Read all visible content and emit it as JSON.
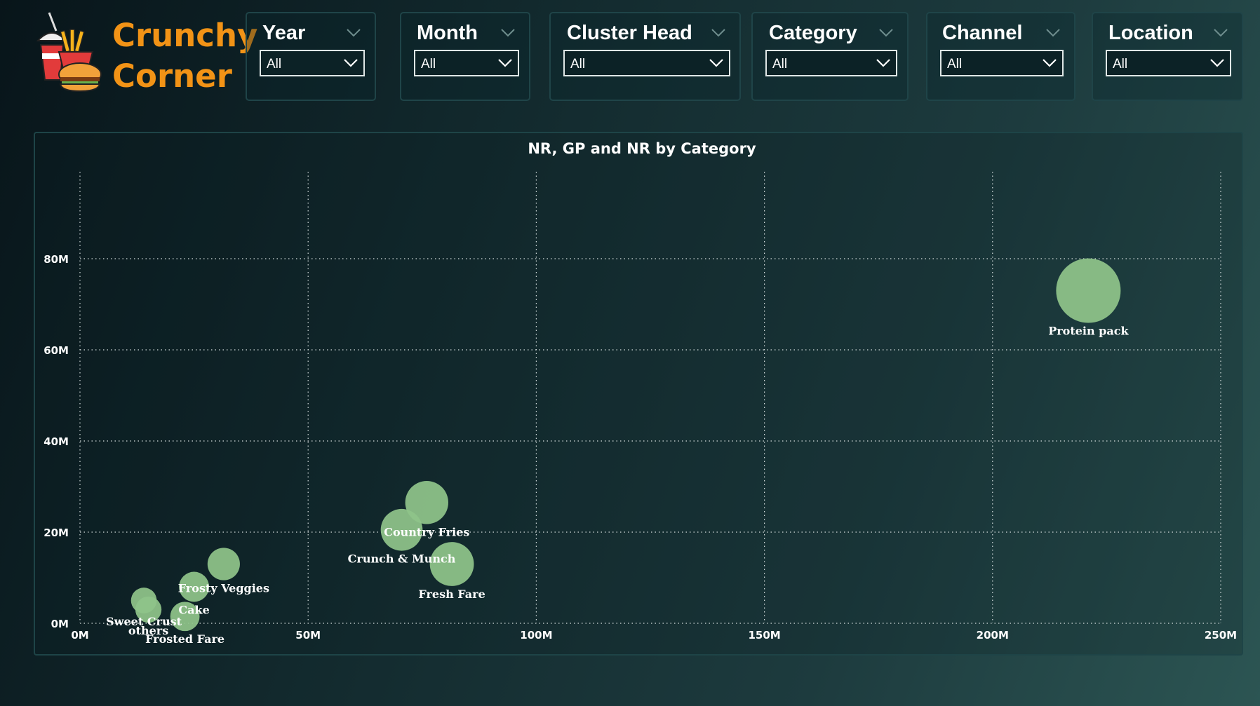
{
  "brand": {
    "line1": "Crunchy",
    "line2": "Corner",
    "logo_icon": "fast-food-icon"
  },
  "filters": [
    {
      "title": "Year",
      "value": "All"
    },
    {
      "title": "Month",
      "value": "All"
    },
    {
      "title": "Cluster Head",
      "value": "All"
    },
    {
      "title": "Category",
      "value": "All"
    },
    {
      "title": "Channel",
      "value": "All"
    },
    {
      "title": "Location",
      "value": "All"
    }
  ],
  "colors": {
    "accent": "#f29316",
    "bubble": "#8fc48a",
    "background": "#12292d"
  },
  "chart_data": {
    "type": "scatter",
    "title": "NR, GP and NR by Category",
    "xlabel": "",
    "ylabel": "",
    "xlim": [
      0,
      250
    ],
    "ylim": [
      0,
      100
    ],
    "x_ticks": [
      0,
      50,
      100,
      150,
      200,
      250
    ],
    "y_ticks": [
      0,
      20,
      40,
      60,
      80
    ],
    "tick_suffix": "M",
    "grid": true,
    "points": [
      {
        "label": "Protein pack",
        "x": 221,
        "y": 73,
        "size": 221
      },
      {
        "label": "Country Fries",
        "x": 76,
        "y": 26.5,
        "size": 76
      },
      {
        "label": "Crunch & Munch",
        "x": 70.5,
        "y": 20.5,
        "size": 70
      },
      {
        "label": "Fresh Fare",
        "x": 81.5,
        "y": 13,
        "size": 81
      },
      {
        "label": "Frosty Veggies",
        "x": 31.5,
        "y": 13,
        "size": 32
      },
      {
        "label": "Cake",
        "x": 25,
        "y": 8,
        "size": 25
      },
      {
        "label": "Sweet Crust",
        "x": 14,
        "y": 5,
        "size": 14
      },
      {
        "label": "others",
        "x": 15,
        "y": 3,
        "size": 15
      },
      {
        "label": "Frosted Fare",
        "x": 23,
        "y": 1.5,
        "size": 23
      }
    ]
  }
}
